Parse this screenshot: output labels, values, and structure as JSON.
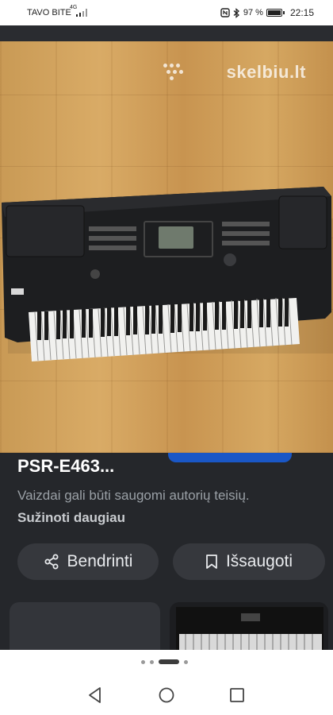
{
  "status_bar": {
    "carrier": "TAVO BITE",
    "network": "4G",
    "battery": "97 %",
    "time": "22:15",
    "icons": [
      "nfc-icon",
      "bluetooth-icon",
      "battery-icon",
      "signal-icon"
    ]
  },
  "viewer": {
    "watermark": "skelbiu.lt"
  },
  "info": {
    "title": "PSR-E463...",
    "copyright_text": "Vaizdai gali būti saugomi autorių teisių.",
    "learn_more": "Sužinoti daugiau",
    "share_label": "Bendrinti",
    "save_label": "Išsaugoti"
  },
  "pager": {
    "count": 4,
    "active_index": 2
  },
  "nav": {
    "buttons": [
      "back-icon",
      "home-icon",
      "recents-icon"
    ]
  },
  "colors": {
    "accent": "#1a57c6",
    "panel": "#25272b",
    "button": "#36383d"
  }
}
